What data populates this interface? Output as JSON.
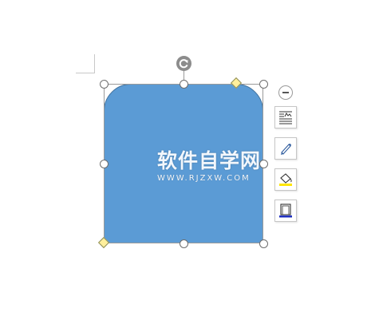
{
  "canvas": {
    "background": "#ffffff"
  },
  "shape": {
    "type": "rounded-top-rectangle",
    "fill": "#5b9bd5",
    "outline": "#41719c"
  },
  "handles": {
    "rotate_icon": "rotate-icon",
    "resize_fill": "#ffffff",
    "adjust_fill": "#ffef9c"
  },
  "toolbar": {
    "collapse_icon": "minus-circle-icon",
    "buttons": [
      {
        "icon": "layout-options-icon"
      },
      {
        "icon": "outline-pen-icon"
      },
      {
        "icon": "fill-bucket-icon",
        "accent": "#ffe600"
      },
      {
        "icon": "border-frame-icon",
        "accent": "#1f2fbf"
      }
    ]
  },
  "watermark": {
    "title": "软件自学网",
    "url": "WWW.RJZXW.COM"
  }
}
